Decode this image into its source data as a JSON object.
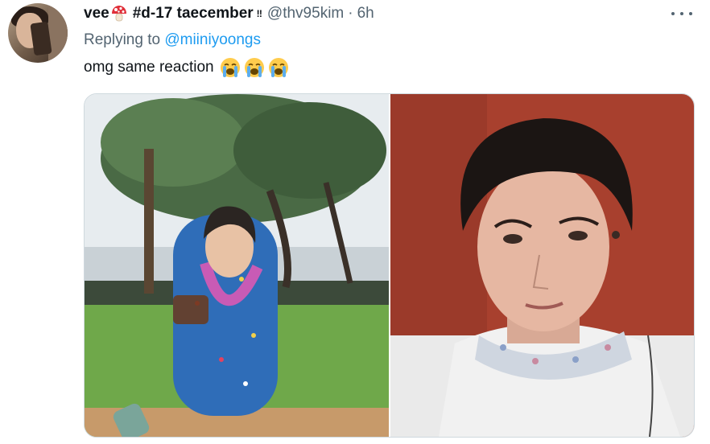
{
  "tweet": {
    "author": {
      "display_name": "vee",
      "name_suffix": "#d-17 taecember",
      "name_badge": "‼",
      "handle": "@thv95kim",
      "separator": "·",
      "timestamp": "6h",
      "name_icon": "mushroom-icon",
      "avatar": "avatar"
    },
    "replying_to": {
      "prefix": "Replying to",
      "user": "@miiniyoongs"
    },
    "text": "omg same reaction",
    "emoji": [
      "loudly-crying-face-icon",
      "loudly-crying-face-icon",
      "loudly-crying-face-icon"
    ],
    "more_icon": "more-options-icon",
    "media": [
      {
        "name": "media-image-left",
        "description_icon": "photo"
      },
      {
        "name": "media-image-right",
        "description_icon": "photo"
      }
    ],
    "colors": {
      "text_primary": "#0f1419",
      "text_secondary": "#536471",
      "link": "#1d9bf0",
      "border": "#cfd9de"
    }
  }
}
